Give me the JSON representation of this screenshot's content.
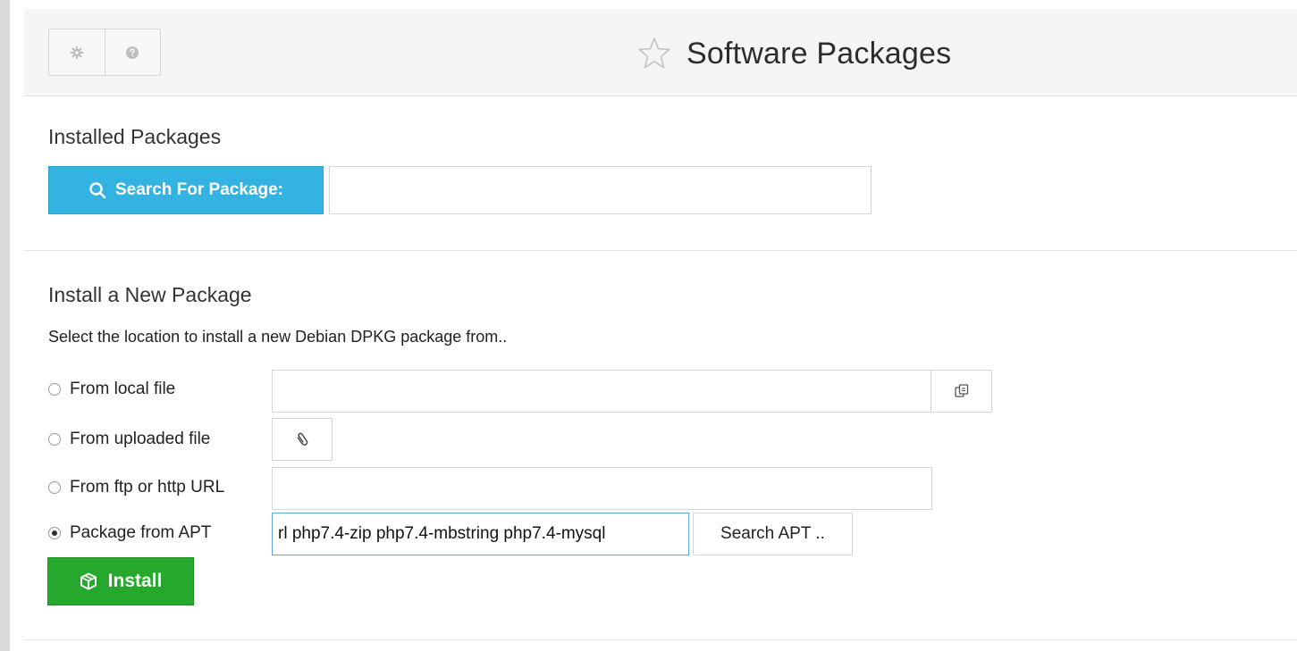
{
  "header": {
    "title": "Software Packages",
    "buttons": [
      {
        "name": "settings-button",
        "icon": "gear-icon"
      },
      {
        "name": "help-button",
        "icon": "help-icon"
      }
    ],
    "title_icon": "star-icon"
  },
  "installed": {
    "section_title": "Installed Packages",
    "search_button_label": "Search For Package:",
    "search_value": ""
  },
  "install_new": {
    "section_title": "Install a New Package",
    "description": "Select the location to install a new Debian DPKG package from..",
    "options": [
      {
        "label": "From local file",
        "selected": false
      },
      {
        "label": "From uploaded file",
        "selected": false
      },
      {
        "label": "From ftp or http URL",
        "selected": false
      },
      {
        "label": "Package from APT",
        "selected": true
      }
    ],
    "local_file_value": "",
    "url_value": "",
    "apt_value": "rl php7.4-zip php7.4-mbstring php7.4-mysql",
    "search_apt_label": "Search APT ..",
    "install_label": "Install"
  },
  "colors": {
    "search_button": "#33b3e2",
    "install_button": "#26a82c"
  }
}
